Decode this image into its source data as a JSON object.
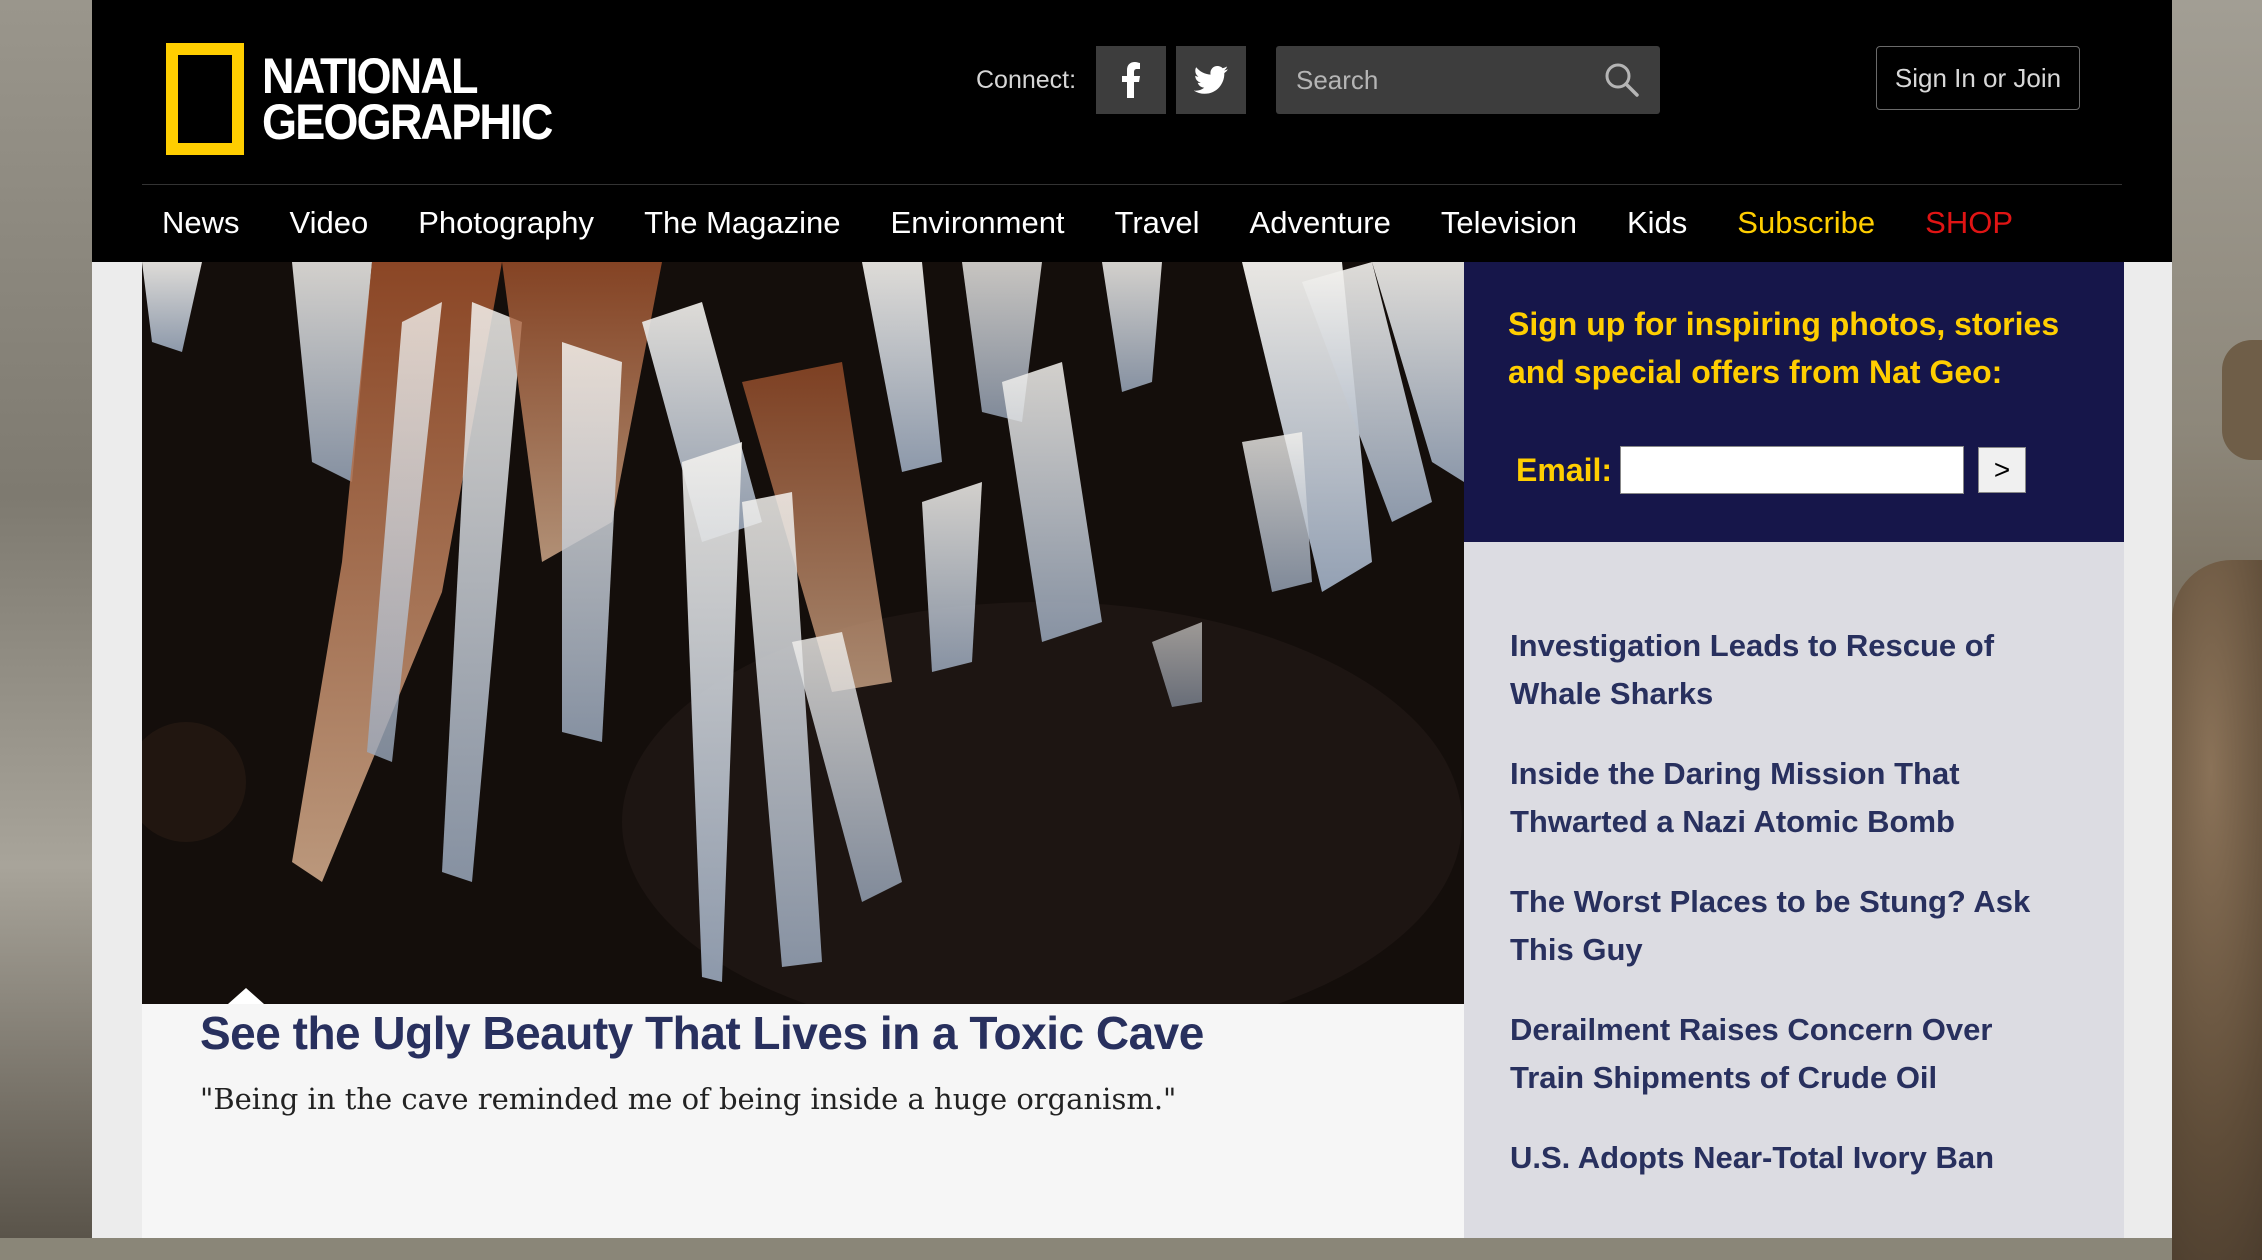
{
  "header": {
    "logo_line1": "NATIONAL",
    "logo_line2": "GEOGRAPHIC",
    "connect_label": "Connect:",
    "search_placeholder": "Search",
    "signin_label": "Sign In or Join"
  },
  "nav": {
    "items": [
      "News",
      "Video",
      "Photography",
      "The Magazine",
      "Environment",
      "Travel",
      "Adventure",
      "Television",
      "Kids",
      "Subscribe",
      "SHOP"
    ]
  },
  "feature": {
    "title": "See the Ugly Beauty That Lives in a Toxic Cave",
    "subtitle": "\"Being in the cave reminded me of being inside a huge organism.\""
  },
  "signup": {
    "text": "Sign up for inspiring photos, stories and special offers from Nat Geo:",
    "email_label": "Email:",
    "submit_label": ">"
  },
  "headlines": [
    "Investigation Leads to Rescue of Whale Sharks",
    "Inside the Daring Mission That Thwarted a Nazi Atomic Bomb",
    "The Worst Places to be Stung? Ask This Guy",
    "Derailment Raises Concern Over Train Shipments of Crude Oil",
    "U.S. Adopts Near-Total Ivory Ban"
  ],
  "colors": {
    "brand_yellow": "#ffce00",
    "headline_navy": "#28305e",
    "signup_bg": "#16164a",
    "shop_red": "#e01414"
  }
}
